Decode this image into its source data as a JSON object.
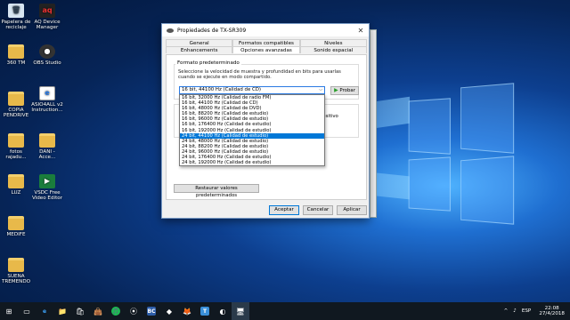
{
  "desktop": {
    "icons": [
      {
        "label": "Papelera de reciclaje",
        "glyph": "🗑"
      },
      {
        "label": "AQ Device Manager",
        "glyph": "aq"
      },
      {
        "label": "360 TM",
        "glyph": ""
      },
      {
        "label": "OBS Studio",
        "glyph": "●"
      },
      {
        "label": "ASIO4ALL v2 Instruction...",
        "glyph": "e"
      },
      {
        "label": "COPIA PENDRIVE",
        "glyph": ""
      },
      {
        "label": "fotos rajadu...",
        "glyph": ""
      },
      {
        "label": "DANI - Acce...",
        "glyph": ""
      },
      {
        "label": "LUZ",
        "glyph": ""
      },
      {
        "label": "VSDC Free Video Editor",
        "glyph": "▶"
      },
      {
        "label": "MEDIFE",
        "glyph": ""
      },
      {
        "label": "SUENA TREMENDO",
        "glyph": ""
      }
    ]
  },
  "dialog": {
    "title": "Propiedades de TX-SR309",
    "close_glyph": "✕",
    "tabs_row1": [
      "General",
      "Formatos compatibles",
      "Niveles"
    ],
    "tabs_row2": [
      "Enhancements",
      "Opciones avanzadas",
      "Sonido espacial"
    ],
    "group_label": "Formato predeterminado",
    "description": "Seleccione la velocidad de muestra y profundidad en bits para usarlas cuando se ejecute en modo compartido.",
    "combo_value": "16 bit, 44100 Hz (Calidad de CD)",
    "test_button": "Probar",
    "group2_text": "dispositivo",
    "options": [
      "16 bit, 32000 Hz (Calidad de radio FM)",
      "16 bit, 44100 Hz (Calidad de CD)",
      "16 bit, 48000 Hz (Calidad de DVD)",
      "16 bit, 88200 Hz (Calidad de estudio)",
      "16 bit, 96000 Hz (Calidad de estudio)",
      "16 bit, 176400 Hz (Calidad de estudio)",
      "16 bit, 192000 Hz (Calidad de estudio)",
      "24 bit, 44100 Hz (Calidad de estudio)",
      "24 bit, 48000 Hz (Calidad de estudio)",
      "24 bit, 88200 Hz (Calidad de estudio)",
      "24 bit, 96000 Hz (Calidad de estudio)",
      "24 bit, 176400 Hz (Calidad de estudio)",
      "24 bit, 192000 Hz (Calidad de estudio)"
    ],
    "selected_option_index": 7,
    "restore_button": "Restaurar valores predeterminados",
    "accept_button": "Aceptar",
    "cancel_button": "Cancelar",
    "apply_button": "Aplicar"
  },
  "taskbar": {
    "apps": [
      "⊞",
      "▭",
      "e",
      "📁",
      "🛍",
      "👜",
      "🎵",
      "⦿",
      "BC",
      "◆",
      "🦊",
      "T",
      "◐",
      "🖥"
    ],
    "tray": [
      "^",
      "♪",
      "ESP"
    ],
    "time": "22:08",
    "date": "27/4/2018"
  }
}
